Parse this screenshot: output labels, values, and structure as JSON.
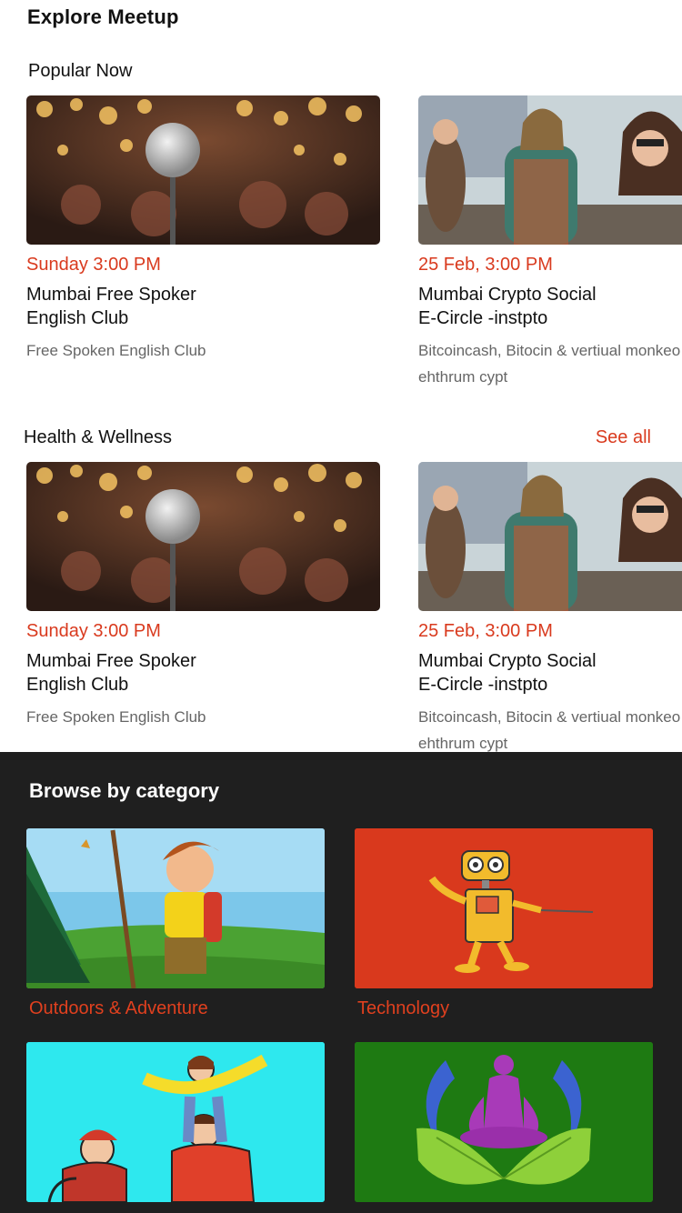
{
  "app": {
    "title": "Explore Meetup"
  },
  "popular": {
    "title": "Popular Now",
    "cards": [
      {
        "date": "Sunday 3:00 PM",
        "name": "Mumbai Free Spoker\nEnglish Club",
        "desc": "Free Spoken English Club",
        "image": "microphone-photo"
      },
      {
        "date": "25 Feb, 3:00 PM",
        "name": "Mumbai Crypto Social\nE-Circle -instpto",
        "desc": "Bitcoincash, Bitocin & vertiual monkeo ehthrum cypt",
        "image": "crowd-photo"
      }
    ]
  },
  "health": {
    "title": "Health & Wellness",
    "see_all": "See all",
    "cards": [
      {
        "date": "Sunday 3:00 PM",
        "name": "Mumbai Free Spoker\nEnglish Club",
        "desc": "Free Spoken English Club",
        "image": "microphone-photo"
      },
      {
        "date": "25 Feb, 3:00 PM",
        "name": "Mumbai Crypto Social\nE-Circle -instpto",
        "desc": "Bitcoincash, Bitocin & vertiual monkeo ehthrum cypt",
        "image": "crowd-photo"
      }
    ]
  },
  "browse": {
    "title": "Browse by category",
    "categories": [
      {
        "label": "Outdoors & Adventure",
        "illustration": "hiker-illustration"
      },
      {
        "label": "Technology",
        "illustration": "robot-illustration"
      },
      {
        "label": "",
        "illustration": "family-illustration"
      },
      {
        "label": "",
        "illustration": "meditation-illustration"
      }
    ]
  },
  "colors": {
    "accent": "#d93a1e",
    "browse_bg": "#1f1f1f",
    "tech_bg": "#d9391d",
    "family_bg": "#2ee8ee",
    "wellness_bg": "#1e7a12"
  }
}
